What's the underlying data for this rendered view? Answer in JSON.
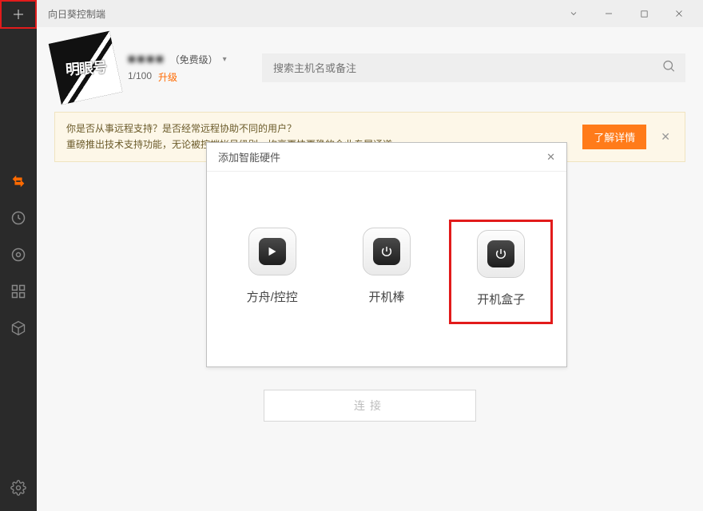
{
  "titlebar": {
    "title": "向日葵控制端"
  },
  "user": {
    "masked_name": "■■■■",
    "level_label": "（免费级）",
    "quota": "1/100",
    "upgrade_label": "升级"
  },
  "search": {
    "placeholder": "搜索主机名或备注"
  },
  "banner": {
    "line1": "你是否从事远程支持？是否经常远程协助不同的用户？",
    "line2": "重磅推出技术支持功能，无论被控端帐号级别，均享更快更稳的企业专属通道",
    "cta": "了解详情"
  },
  "dialog": {
    "title": "添加智能硬件",
    "items": [
      {
        "label": "方舟/控控"
      },
      {
        "label": "开机棒"
      },
      {
        "label": "开机盒子"
      }
    ]
  },
  "connect": {
    "label": "连接"
  },
  "avatar": {
    "text": "明眼号"
  }
}
